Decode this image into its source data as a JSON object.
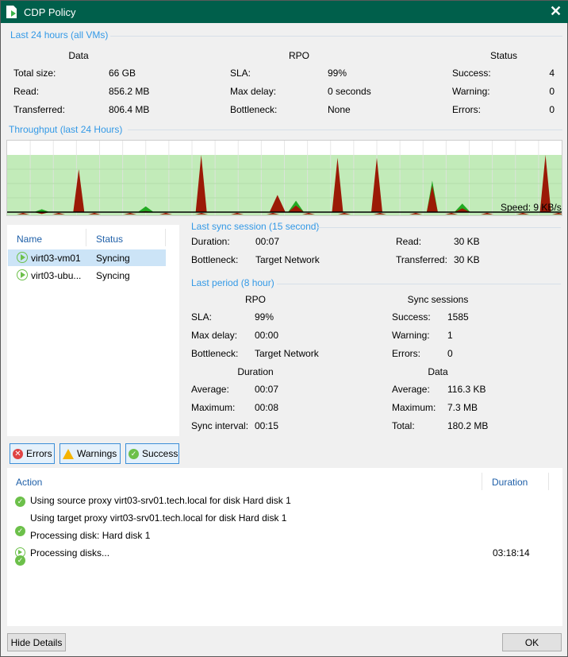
{
  "window": {
    "title": "CDP Policy",
    "close_icon": "close-icon",
    "doc_icon": "document-icon"
  },
  "summary": {
    "section": "Last 24 hours (all VMs)",
    "data": {
      "header": "Data",
      "rows": [
        [
          "Total size:",
          "66 GB"
        ],
        [
          "Read:",
          "856.2 MB"
        ],
        [
          "Transferred:",
          "806.4 MB"
        ]
      ]
    },
    "rpo": {
      "header": "RPO",
      "rows": [
        [
          "SLA:",
          "99%"
        ],
        [
          "Max delay:",
          "0 seconds"
        ],
        [
          "Bottleneck:",
          "None"
        ]
      ]
    },
    "status": {
      "header": "Status",
      "rows": [
        [
          "Success:",
          "4"
        ],
        [
          "Warning:",
          "0"
        ],
        [
          "Errors:",
          "0"
        ]
      ]
    }
  },
  "throughput": {
    "section": "Throughput (last 24 Hours)",
    "speed": "Speed: 9 KB/s"
  },
  "chart_data": {
    "type": "area",
    "x_unit": "hours",
    "xlim": [
      0,
      24
    ],
    "ylim": [
      0,
      1
    ],
    "peaks": [
      {
        "x": 1.5,
        "y": 0.05,
        "s": "read"
      },
      {
        "x": 3.1,
        "y": 0.75,
        "s": "transfer"
      },
      {
        "x": 6.0,
        "y": 0.1,
        "s": "read"
      },
      {
        "x": 8.4,
        "y": 1.0,
        "s": "transfer"
      },
      {
        "x": 11.7,
        "y": 0.3,
        "s": "transfer"
      },
      {
        "x": 12.5,
        "y": 0.2,
        "s": "read"
      },
      {
        "x": 14.3,
        "y": 0.95,
        "s": "transfer"
      },
      {
        "x": 16.0,
        "y": 0.95,
        "s": "transfer"
      },
      {
        "x": 18.4,
        "y": 0.55,
        "s": "read"
      },
      {
        "x": 19.7,
        "y": 0.15,
        "s": "read"
      },
      {
        "x": 23.3,
        "y": 1.0,
        "s": "transfer"
      }
    ],
    "colors": {
      "background": "#c2ebb9",
      "transfer": "#9b1a06",
      "read": "#22aa22"
    }
  },
  "vms": {
    "columns": [
      "Name",
      "Status"
    ],
    "rows": [
      {
        "name": "virt03-vm01",
        "status": "Syncing"
      },
      {
        "name": "virt03-ubu...",
        "status": "Syncing"
      }
    ]
  },
  "filters": {
    "errors": "Errors",
    "warnings": "Warnings",
    "success": "Success"
  },
  "last_sync": {
    "section": "Last sync session (15 second)",
    "left": [
      [
        "Duration:",
        "00:07"
      ],
      [
        "Bottleneck:",
        "Target Network"
      ]
    ],
    "right": [
      [
        "Read:",
        "30 KB"
      ],
      [
        "Transferred:",
        "30 KB"
      ]
    ]
  },
  "last_period": {
    "section": "Last period (8 hour)",
    "rpo": {
      "header": "RPO",
      "rows": [
        [
          "SLA:",
          "99%"
        ],
        [
          "Max delay:",
          "00:00"
        ],
        [
          "Bottleneck:",
          "Target Network"
        ]
      ]
    },
    "sessions": {
      "header": "Sync sessions",
      "rows": [
        [
          "Success:",
          "1585"
        ],
        [
          "Warning:",
          "1"
        ],
        [
          "Errors:",
          "0"
        ]
      ]
    },
    "duration": {
      "header": "Duration",
      "rows": [
        [
          "Average:",
          "00:07"
        ],
        [
          "Maximum:",
          "00:08"
        ],
        [
          "Sync interval:",
          "00:15"
        ]
      ]
    },
    "data": {
      "header": "Data",
      "rows": [
        [
          "Average:",
          "116.3 KB"
        ],
        [
          "Maximum:",
          "7.3 MB"
        ],
        [
          "Total:",
          "180.2 MB"
        ]
      ]
    }
  },
  "log": {
    "columns": [
      "Action",
      "Duration"
    ],
    "rows": [
      {
        "icon": "success",
        "action": "Using source proxy virt03-srv01.tech.local for disk Hard disk 1",
        "duration": ""
      },
      {
        "icon": "success",
        "action": "Using target proxy virt03-srv01.tech.local for disk Hard disk 1",
        "duration": ""
      },
      {
        "icon": "success",
        "action": "Processing disk: Hard disk 1",
        "duration": ""
      },
      {
        "icon": "running",
        "action": "Processing disks...",
        "duration": "03:18:14"
      }
    ]
  },
  "footer": {
    "hide_details": "Hide Details",
    "ok": "OK"
  }
}
